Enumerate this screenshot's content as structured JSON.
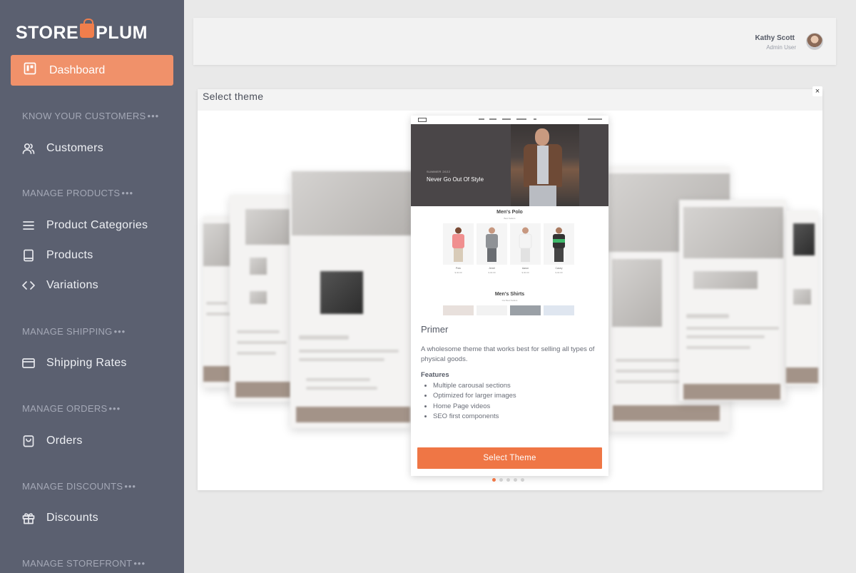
{
  "brand": {
    "logo_left": "STORE",
    "logo_right": "PLUM"
  },
  "sidebar": {
    "active": {
      "label": "Dashboard"
    },
    "sections": [
      {
        "title": "KNOW YOUR CUSTOMERS",
        "items": [
          {
            "label": "Customers",
            "icon": "users-icon"
          }
        ]
      },
      {
        "title": "MANAGE PRODUCTS",
        "items": [
          {
            "label": "Product Categories",
            "icon": "list-icon"
          },
          {
            "label": "Products",
            "icon": "book-icon"
          },
          {
            "label": "Variations",
            "icon": "code-icon"
          }
        ]
      },
      {
        "title": "MANAGE SHIPPING",
        "items": [
          {
            "label": "Shipping Rates",
            "icon": "credit-card-icon"
          }
        ]
      },
      {
        "title": "MANAGE ORDERS",
        "items": [
          {
            "label": "Orders",
            "icon": "shopping-bag-icon"
          }
        ]
      },
      {
        "title": "MANAGE DISCOUNTS",
        "items": [
          {
            "label": "Discounts",
            "icon": "gift-icon"
          }
        ]
      },
      {
        "title": "MANAGE STOREFRONT",
        "items": []
      }
    ],
    "dots": "•••"
  },
  "header": {
    "user_name": "Kathy Scott",
    "user_role": "Admin User"
  },
  "modal": {
    "title": "Select theme",
    "close": "×",
    "preview": {
      "hero_kicker": "SUMMER 2022",
      "hero_title": "Never Go Out Of Style",
      "section1": "Men's Polo",
      "section1_sub": "Best Sellers",
      "products": [
        {
          "name": "Polo",
          "price": "$ 00.00"
        },
        {
          "name": "Jerrel",
          "price": "$ 00.00"
        },
        {
          "name": "Aaron",
          "price": "$ 00.00"
        },
        {
          "name": "Casey",
          "price": "$ 00.00"
        }
      ],
      "section2": "Men's Shirts",
      "section2_sub": "Our Best Sellers"
    },
    "theme": {
      "name": "Primer",
      "description": "A wholesome theme that works best for selling all types of physical goods.",
      "features_title": "Features",
      "features": [
        "Multiple carousal sections",
        "Optimized for larger images",
        "Home Page videos",
        "SEO first components"
      ]
    },
    "select_button": "Select Theme",
    "pages": 5,
    "current_page": 1
  },
  "colors": {
    "sidebar": "#5b6070",
    "accent": "#ef7645",
    "active_nav": "#f0916a"
  }
}
